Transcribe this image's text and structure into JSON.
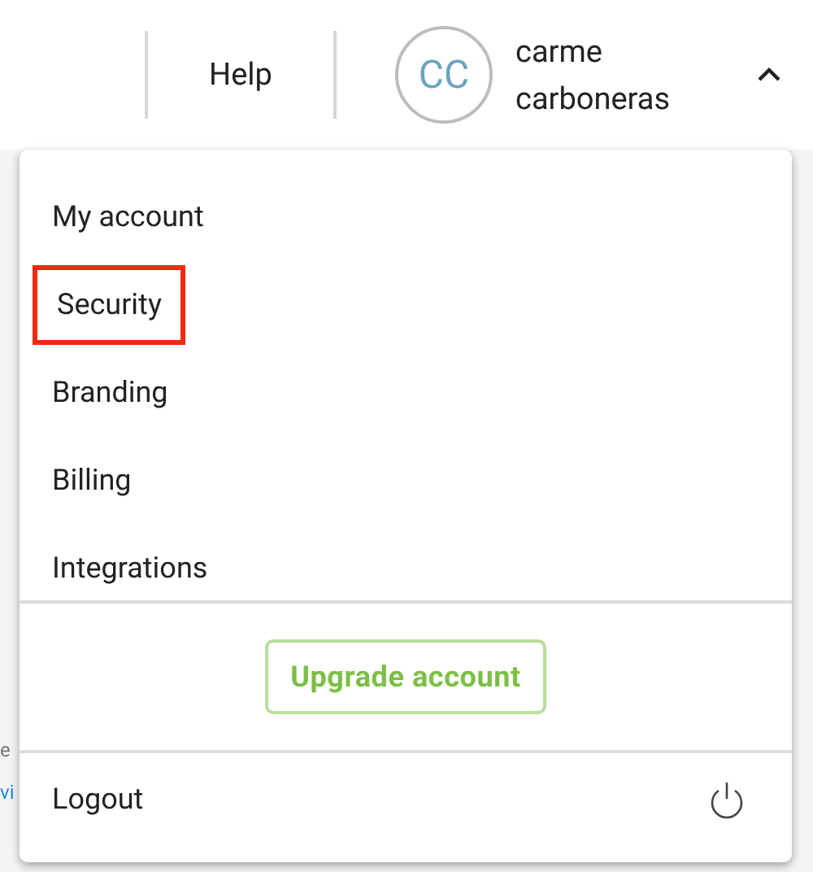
{
  "header": {
    "help": "Help",
    "user": {
      "initials": "CC",
      "name": "carme carboneras"
    },
    "menu_expanded": true
  },
  "page_fragments": [
    {
      "text": "e",
      "kind": "plain"
    },
    {
      "text": "vi",
      "kind": "link"
    }
  ],
  "menu": {
    "items": [
      {
        "label": "My account",
        "highlighted": false
      },
      {
        "label": "Security",
        "highlighted": true
      },
      {
        "label": "Branding",
        "highlighted": false
      },
      {
        "label": "Billing",
        "highlighted": false
      },
      {
        "label": "Integrations",
        "highlighted": false
      }
    ],
    "upgrade_button": "Upgrade account",
    "logout": "Logout"
  }
}
